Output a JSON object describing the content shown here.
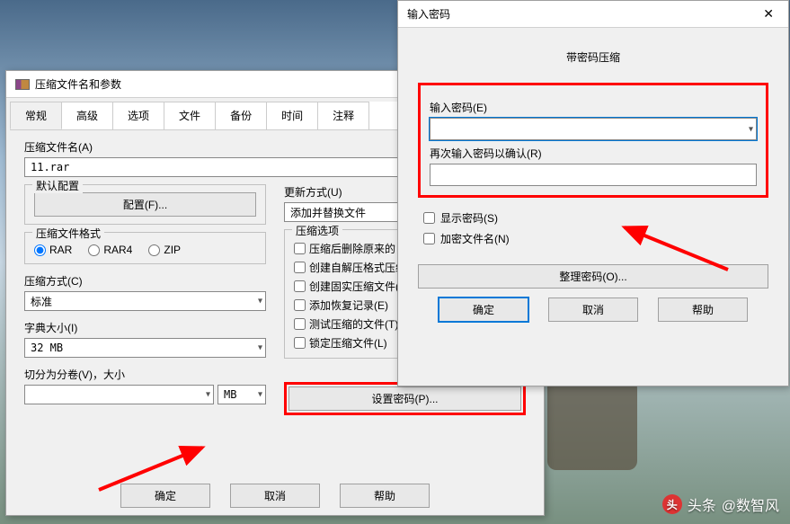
{
  "main": {
    "title": "压缩文件名和参数",
    "tabs": [
      "常规",
      "高级",
      "选项",
      "文件",
      "备份",
      "时间",
      "注释"
    ],
    "filename_label": "压缩文件名(A)",
    "filename_value": "11.rar",
    "default_profile_label": "默认配置",
    "profile_button": "配置(F)...",
    "format_label": "压缩文件格式",
    "formats": {
      "rar": "RAR",
      "rar4": "RAR4",
      "zip": "ZIP"
    },
    "method_label": "压缩方式(C)",
    "method_value": "标准",
    "dict_label": "字典大小(I)",
    "dict_value": "32 MB",
    "volume_label": "切分为分卷(V)，大小",
    "volume_value": "",
    "volume_unit": "MB",
    "update_label": "更新方式(U)",
    "update_value": "添加并替换文件",
    "options_label": "压缩选项",
    "options": [
      "压缩后删除原来的",
      "创建自解压格式压约",
      "创建固实压缩文件(",
      "添加恢复记录(E)",
      "测试压缩的文件(T)",
      "锁定压缩文件(L)"
    ],
    "set_password": "设置密码(P)...",
    "ok": "确定",
    "cancel": "取消",
    "help": "帮助"
  },
  "pwd": {
    "title": "输入密码",
    "heading": "带密码压缩",
    "enter_label": "输入密码(E)",
    "confirm_label": "再次输入密码以确认(R)",
    "show_pwd": "显示密码(S)",
    "encrypt_names": "加密文件名(N)",
    "organize": "整理密码(O)...",
    "ok": "确定",
    "cancel": "取消",
    "help": "帮助"
  },
  "watermark": {
    "prefix": "头条",
    "author": "@数智风"
  }
}
